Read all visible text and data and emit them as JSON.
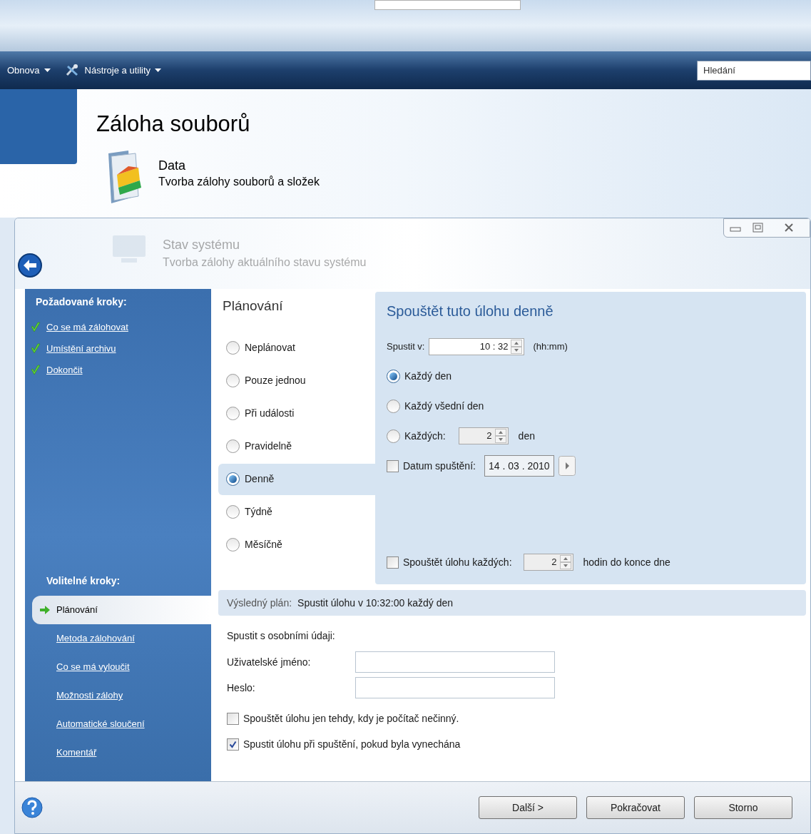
{
  "toolbar": {
    "menus": [
      {
        "label": "Obnova",
        "kind": "plain"
      },
      {
        "label": "Nástroje a utility",
        "kind": "tools"
      }
    ],
    "search": {
      "placeholder": "Hledání"
    }
  },
  "header": {
    "title": "Záloha souborů",
    "items": [
      {
        "title": "Data",
        "subtitle": "Tvorba zálohy souborů a složek",
        "faded": false
      },
      {
        "title": "Stav systému",
        "subtitle": "Tvorba zálohy aktuálního stavu systému",
        "faded": true
      }
    ]
  },
  "sidebar": {
    "required_heading": "Požadované kroky:",
    "required_steps": [
      {
        "label": "Co se má zálohovat",
        "done": true
      },
      {
        "label": "Umístění archivu",
        "done": true
      },
      {
        "label": "Dokončit",
        "done": true
      }
    ],
    "optional_heading": "Volitelné kroky:",
    "optional_steps": [
      {
        "label": "Plánování",
        "selected": true
      },
      {
        "label": "Metoda zálohování",
        "selected": false
      },
      {
        "label": "Co se má vyloučit",
        "selected": false
      },
      {
        "label": "Možnosti zálohy",
        "selected": false
      },
      {
        "label": "Automatické sloučení",
        "selected": false
      },
      {
        "label": "Komentář",
        "selected": false
      }
    ]
  },
  "schedule": {
    "heading": "Plánování",
    "options": [
      {
        "label": "Neplánovat",
        "selected": false
      },
      {
        "label": "Pouze jednou",
        "selected": false
      },
      {
        "label": "Při události",
        "selected": false
      },
      {
        "label": "Pravidelně",
        "selected": false
      },
      {
        "label": "Denně",
        "selected": true
      },
      {
        "label": "Týdně",
        "selected": false
      },
      {
        "label": "Měsíčně",
        "selected": false
      }
    ]
  },
  "daily": {
    "title": "Spouštět tuto úlohu denně",
    "start_time": {
      "label": "Spustit v:",
      "value": "10 : 32",
      "unit": "(hh:mm)"
    },
    "modes": [
      {
        "kind": "plain",
        "label": "Každý den",
        "selected": true
      },
      {
        "kind": "plain",
        "label": "Každý všední den",
        "selected": false
      },
      {
        "kind": "interval",
        "label": "Každých:",
        "value": "2",
        "unit": "den",
        "selected": false
      }
    ],
    "start_date": {
      "label": "Datum spuštění:",
      "value": "14 . 03 . 2010",
      "checked": false
    },
    "repeat": {
      "label": "Spouštět úlohu každých:",
      "value": "2",
      "unit": "hodin do konce dne",
      "checked": false
    }
  },
  "result": {
    "label": "Výsledný plán:",
    "value": "Spustit úlohu v 10:32:00 každý den"
  },
  "credentials": {
    "heading": "Spustit s osobními údaji:",
    "fields": [
      {
        "label": "Uživatelské jméno:"
      },
      {
        "label": "Heslo:"
      }
    ]
  },
  "options": [
    {
      "label": "Spouštět úlohu jen tehdy, kdy je počítač nečinný.",
      "checked": false
    },
    {
      "label": "Spustit úlohu při spuštění, pokud byla vynechána",
      "checked": true
    }
  ],
  "buttons": [
    "Další >",
    "Pokračovat",
    "Storno"
  ]
}
